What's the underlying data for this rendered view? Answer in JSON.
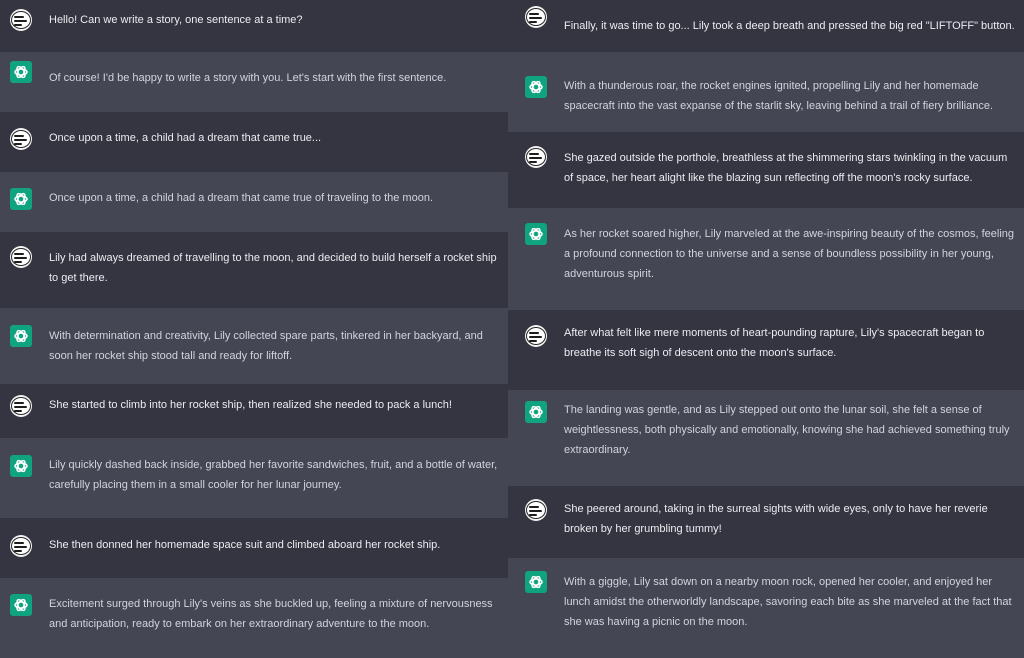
{
  "colors": {
    "user_bg": "#343541",
    "assistant_bg": "#444654",
    "ai_avatar": "#10a37f",
    "user_text": "#ececf1",
    "assistant_text": "#d1d5db"
  },
  "icons": {
    "assistant": "openai-logo-icon",
    "user": "user-avatar-icon"
  },
  "left_column": [
    {
      "role": "user",
      "text": "Hello! Can we write a story, one sentence at a time?"
    },
    {
      "role": "assistant",
      "text": "Of course! I'd be happy to write a story with you. Let's start with the first sentence."
    },
    {
      "role": "user",
      "text": "Once upon a time, a child had a dream that came true..."
    },
    {
      "role": "assistant",
      "text": "Once upon a time, a child had a dream that came true of traveling to the moon."
    },
    {
      "role": "user",
      "text": "Lily had always dreamed of travelling to the moon, and decided to build herself a rocket ship to get there."
    },
    {
      "role": "assistant",
      "text": "With determination and creativity, Lily collected spare parts, tinkered in her backyard, and soon her rocket ship stood tall and ready for liftoff."
    },
    {
      "role": "user",
      "text": "She started to climb into her rocket ship, then realized she needed to pack a lunch!"
    },
    {
      "role": "assistant",
      "text": "Lily quickly dashed back inside, grabbed her favorite sandwiches, fruit, and a bottle of water, carefully placing them in a small cooler for her lunar journey."
    },
    {
      "role": "user",
      "text": "She then donned her homemade space suit and climbed aboard her rocket ship."
    },
    {
      "role": "assistant",
      "text": "Excitement surged through Lily's veins as she buckled up, feeling a mixture of nervousness and anticipation, ready to embark on her extraordinary adventure to the moon."
    }
  ],
  "right_column": [
    {
      "role": "user",
      "text": "Finally, it was time to go... Lily took a deep breath and pressed the big red \"LIFTOFF\" button."
    },
    {
      "role": "assistant",
      "text": "With a thunderous roar, the rocket engines ignited, propelling Lily and her homemade spacecraft into the vast expanse of the starlit sky, leaving behind a trail of fiery brilliance."
    },
    {
      "role": "user",
      "text": "She gazed outside the porthole, breathless at the shimmering stars twinkling in the vacuum of space, her heart alight like the blazing sun reflecting off the moon's rocky surface."
    },
    {
      "role": "assistant",
      "text": "As her rocket soared higher, Lily marveled at the awe-inspiring beauty of the cosmos, feeling a profound connection to the universe and a sense of boundless possibility in her young, adventurous spirit."
    },
    {
      "role": "user",
      "text": "After what felt like mere moments of heart-pounding rapture, Lily's spacecraft began to breathe its soft sigh of descent onto the moon's surface."
    },
    {
      "role": "assistant",
      "text": "The landing was gentle, and as Lily stepped out onto the lunar soil, she felt a sense of weightlessness, both physically and emotionally, knowing she had achieved something truly extraordinary."
    },
    {
      "role": "user",
      "text": "She peered around, taking in the surreal sights with wide eyes, only to have her reverie broken by her grumbling tummy!"
    },
    {
      "role": "assistant",
      "text": "With a giggle, Lily sat down on a nearby moon rock, opened her cooler, and enjoyed her lunch amidst the otherworldly landscape, savoring each bite as she marveled at the fact that she was having a picnic on the moon."
    }
  ]
}
